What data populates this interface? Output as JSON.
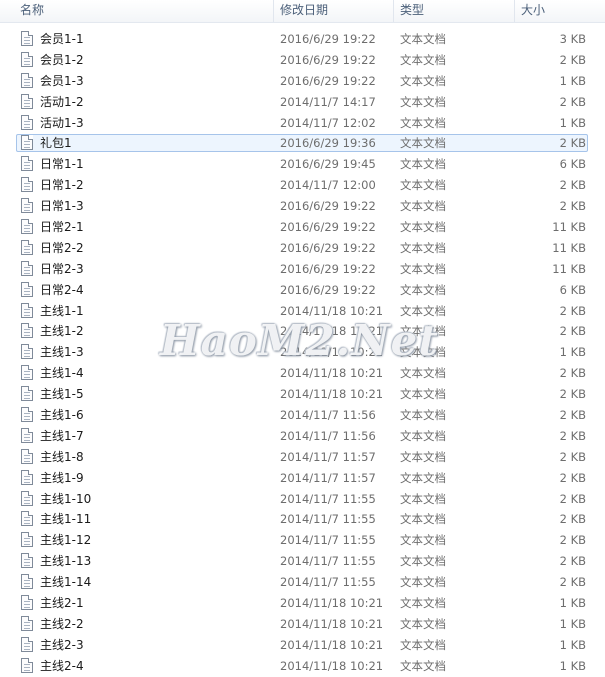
{
  "columns": {
    "name": "名称",
    "modified": "修改日期",
    "type": "类型",
    "size": "大小"
  },
  "selected_index": 5,
  "watermark": "HaoM2.Net",
  "files": [
    {
      "name": "会员1-1",
      "modified": "2016/6/29 19:22",
      "type": "文本文档",
      "size": "3 KB"
    },
    {
      "name": "会员1-2",
      "modified": "2016/6/29 19:22",
      "type": "文本文档",
      "size": "2 KB"
    },
    {
      "name": "会员1-3",
      "modified": "2016/6/29 19:22",
      "type": "文本文档",
      "size": "1 KB"
    },
    {
      "name": "活动1-2",
      "modified": "2014/11/7 14:17",
      "type": "文本文档",
      "size": "2 KB"
    },
    {
      "name": "活动1-3",
      "modified": "2014/11/7 12:02",
      "type": "文本文档",
      "size": "1 KB"
    },
    {
      "name": "礼包1",
      "modified": "2016/6/29 19:36",
      "type": "文本文档",
      "size": "2 KB"
    },
    {
      "name": "日常1-1",
      "modified": "2016/6/29 19:45",
      "type": "文本文档",
      "size": "6 KB"
    },
    {
      "name": "日常1-2",
      "modified": "2014/11/7 12:00",
      "type": "文本文档",
      "size": "2 KB"
    },
    {
      "name": "日常1-3",
      "modified": "2016/6/29 19:22",
      "type": "文本文档",
      "size": "2 KB"
    },
    {
      "name": "日常2-1",
      "modified": "2016/6/29 19:22",
      "type": "文本文档",
      "size": "11 KB"
    },
    {
      "name": "日常2-2",
      "modified": "2016/6/29 19:22",
      "type": "文本文档",
      "size": "11 KB"
    },
    {
      "name": "日常2-3",
      "modified": "2016/6/29 19:22",
      "type": "文本文档",
      "size": "11 KB"
    },
    {
      "name": "日常2-4",
      "modified": "2016/6/29 19:22",
      "type": "文本文档",
      "size": "6 KB"
    },
    {
      "name": "主线1-1",
      "modified": "2014/11/18 10:21",
      "type": "文本文档",
      "size": "2 KB"
    },
    {
      "name": "主线1-2",
      "modified": "2014/11/18 10:21",
      "type": "文本文档",
      "size": "2 KB"
    },
    {
      "name": "主线1-3",
      "modified": "2014/11/18 10:21",
      "type": "文本文档",
      "size": "1 KB"
    },
    {
      "name": "主线1-4",
      "modified": "2014/11/18 10:21",
      "type": "文本文档",
      "size": "2 KB"
    },
    {
      "name": "主线1-5",
      "modified": "2014/11/18 10:21",
      "type": "文本文档",
      "size": "2 KB"
    },
    {
      "name": "主线1-6",
      "modified": "2014/11/7 11:56",
      "type": "文本文档",
      "size": "2 KB"
    },
    {
      "name": "主线1-7",
      "modified": "2014/11/7 11:56",
      "type": "文本文档",
      "size": "2 KB"
    },
    {
      "name": "主线1-8",
      "modified": "2014/11/7 11:57",
      "type": "文本文档",
      "size": "2 KB"
    },
    {
      "name": "主线1-9",
      "modified": "2014/11/7 11:57",
      "type": "文本文档",
      "size": "2 KB"
    },
    {
      "name": "主线1-10",
      "modified": "2014/11/7 11:55",
      "type": "文本文档",
      "size": "2 KB"
    },
    {
      "name": "主线1-11",
      "modified": "2014/11/7 11:55",
      "type": "文本文档",
      "size": "2 KB"
    },
    {
      "name": "主线1-12",
      "modified": "2014/11/7 11:55",
      "type": "文本文档",
      "size": "2 KB"
    },
    {
      "name": "主线1-13",
      "modified": "2014/11/7 11:55",
      "type": "文本文档",
      "size": "2 KB"
    },
    {
      "name": "主线1-14",
      "modified": "2014/11/7 11:55",
      "type": "文本文档",
      "size": "2 KB"
    },
    {
      "name": "主线2-1",
      "modified": "2014/11/18 10:21",
      "type": "文本文档",
      "size": "1 KB"
    },
    {
      "name": "主线2-2",
      "modified": "2014/11/18 10:21",
      "type": "文本文档",
      "size": "1 KB"
    },
    {
      "name": "主线2-3",
      "modified": "2014/11/18 10:21",
      "type": "文本文档",
      "size": "1 KB"
    },
    {
      "name": "主线2-4",
      "modified": "2014/11/18 10:21",
      "type": "文本文档",
      "size": "1 KB"
    }
  ]
}
